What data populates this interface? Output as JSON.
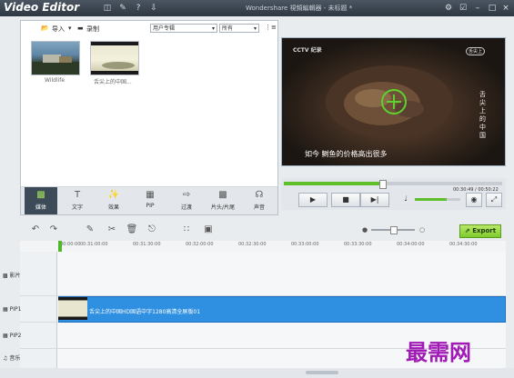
{
  "app": {
    "logo": "Video Editor",
    "title": "Wondershare 視頻編輯器 - 未标题 *",
    "toolbar_icons": [
      "save-icon",
      "chat-icon",
      "help-icon",
      "download-icon"
    ],
    "window_icons": [
      "settings-icon",
      "cart-icon",
      "minimize-icon",
      "maximize-icon",
      "close-icon"
    ]
  },
  "media": {
    "import_label": "导入",
    "record_label": "录制",
    "collection_select": "用户专辑",
    "filter_select": "所有",
    "items": [
      {
        "caption": "Wildlife"
      },
      {
        "caption": "舌尖上的中国..."
      }
    ]
  },
  "library_tabs": [
    {
      "label": "媒体",
      "icon": "film-icon",
      "active": true
    },
    {
      "label": "文字",
      "icon": "text-icon",
      "active": false
    },
    {
      "label": "效果",
      "icon": "magic-wand-icon",
      "active": false
    },
    {
      "label": "PIP",
      "icon": "pip-icon",
      "active": false
    },
    {
      "label": "过渡",
      "icon": "transition-icon",
      "active": false
    },
    {
      "label": "片头/片尾",
      "icon": "intro-icon",
      "active": false
    },
    {
      "label": "声音",
      "icon": "headphones-icon",
      "active": false
    }
  ],
  "preview": {
    "channel_logo": "CCTV 纪录",
    "time_badge": "舌尖上",
    "subtitle": "如今 鲥鱼的价格高出很多",
    "side_text": "舌尖上的中国"
  },
  "player": {
    "time": "00:30:49 / 00:50:22",
    "progress": 0.45,
    "volume": 0.7
  },
  "timeline": {
    "export_label": "Export",
    "zoom": 0.5,
    "ticks": [
      "00:00:00",
      "00:31:00:00",
      "00:31:30:00",
      "00:32:00:00",
      "00:32:30:00",
      "00:33:00:00",
      "00:33:30:00",
      "00:34:00:00",
      "00:34:30:00"
    ],
    "tracks": [
      {
        "label": "影片"
      },
      {
        "label": "PIP1"
      },
      {
        "label": "PIP2"
      },
      {
        "label": "音乐"
      }
    ],
    "clip_label": "舌尖上的中国HD国语中字1280高清全屏版01"
  },
  "watermark": "最需网",
  "colors": {
    "accent": "#2f8fe0",
    "export": "#7ecb2c",
    "watermark": "#a01bb5"
  }
}
